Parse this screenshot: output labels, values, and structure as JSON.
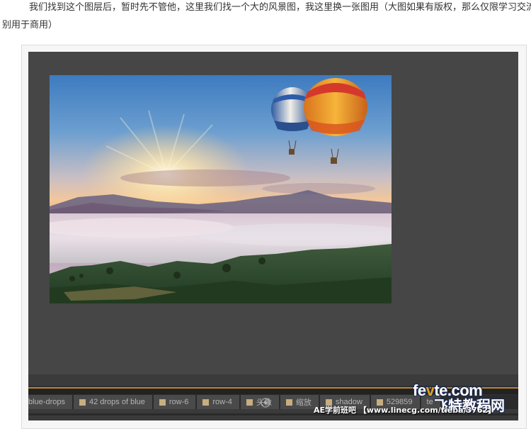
{
  "article": {
    "line1": "我们找到这个图层后，暂时先不管他，这里我们找一个大的风景图，我这里换一张图用（大图如果有版权，那么仅限学习交流，",
    "line2": "别用于商用）"
  },
  "timeline_tabs": [
    {
      "label": "blue-drops",
      "swatch": false
    },
    {
      "label": "42 drops of blue",
      "swatch": true
    },
    {
      "label": "row-6",
      "swatch": true
    },
    {
      "label": "row-4",
      "swatch": true
    },
    {
      "label": "头像",
      "swatch": true
    },
    {
      "label": "缩放",
      "swatch": true
    },
    {
      "label": "shadow",
      "swatch": true
    },
    {
      "label": "529859",
      "swatch": true
    },
    {
      "label": "te",
      "swatch": false
    }
  ],
  "watermark": {
    "logo_part1": "fe",
    "logo_part2": "v",
    "logo_part3": "te.com",
    "logo_cn": "飞特教程网",
    "bottom": "AE学前班吧 【www.linecg.com/tieba/3762】"
  },
  "colors": {
    "tab_swatch": "#c8ad7f",
    "accent_line": "#b8862f",
    "viewer_bg": "#464646"
  }
}
